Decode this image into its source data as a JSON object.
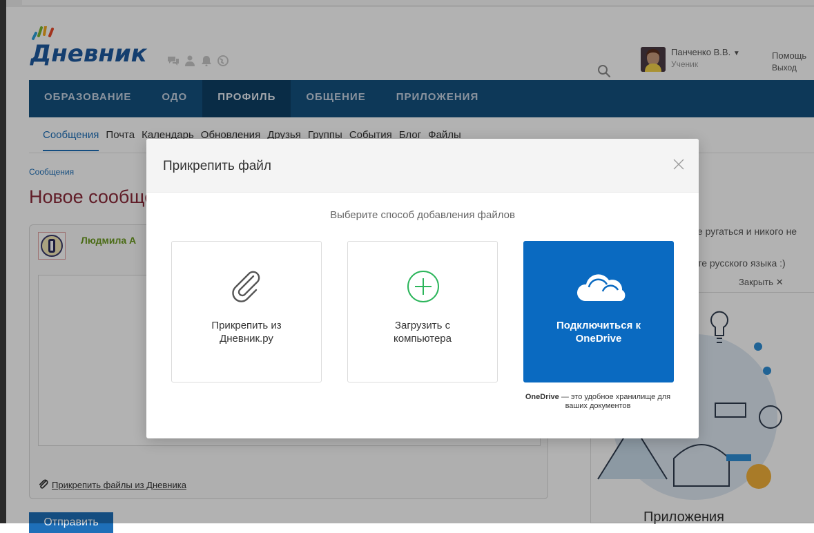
{
  "app": {
    "logo_text": "Дневник",
    "user_name": "Панченко В.В.",
    "user_role": "Ученик",
    "help_link": "Помощь",
    "logout_link": "Выход"
  },
  "main_nav": {
    "items": [
      "ОБРАЗОВАНИЕ",
      "ОДО",
      "ПРОФИЛЬ",
      "ОБЩЕНИЕ",
      "ПРИЛОЖЕНИЯ"
    ],
    "active": "ПРОФИЛЬ"
  },
  "sub_nav": {
    "items": [
      "Сообщения",
      "Почта",
      "Календарь",
      "Обновления",
      "Друзья",
      "Группы",
      "События",
      "Блог",
      "Файлы"
    ],
    "active": "Сообщения"
  },
  "page": {
    "breadcrumb": "Сообщения",
    "title": "Новое сообщение",
    "sender_name": "Людмила А",
    "attach_link": "Прикрепить файлы из Дневника",
    "send_button": "Отправить"
  },
  "sidebar": {
    "text_1": "е ругаться и никого не",
    "text_2": "те русского языка :)",
    "close_label": "Закрыть",
    "apps_title": "Приложения"
  },
  "modal": {
    "title": "Прикрепить файл",
    "subtitle": "Выберите способ добавления файлов",
    "options": [
      {
        "label_1": "Прикрепить из",
        "label_2": "Дневник.ру",
        "icon": "paperclip-icon"
      },
      {
        "label_1": "Загрузить с",
        "label_2": "компьютера",
        "icon": "plus-circle-icon"
      },
      {
        "label_1": "Подключиться к",
        "label_2": "OneDrive",
        "icon": "cloud-icon"
      }
    ],
    "note_brand": "OneDrive",
    "note_text": "— это удобное хранилище для ваших документов"
  },
  "colors": {
    "brand_blue": "#13517f",
    "onedrive_blue": "#0a6ac1",
    "plus_green": "#2bb55a",
    "title_red": "#8b2a3a"
  }
}
